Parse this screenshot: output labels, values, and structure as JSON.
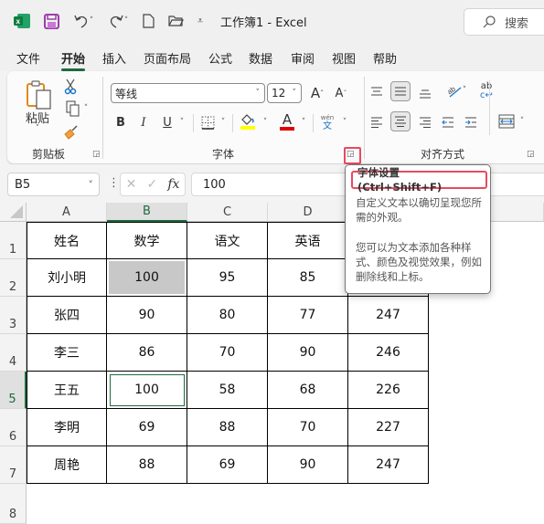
{
  "titlebar": {
    "title": "工作簿1  -  Excel",
    "search_label": "搜索",
    "icons": [
      "excel-logo-icon",
      "save-icon",
      "undo-icon",
      "redo-icon",
      "new-file-icon",
      "open-folder-icon",
      "customize-icon"
    ]
  },
  "tabs": [
    {
      "label": "文件",
      "active": false
    },
    {
      "label": "开始",
      "active": true
    },
    {
      "label": "插入",
      "active": false
    },
    {
      "label": "页面布局",
      "active": false
    },
    {
      "label": "公式",
      "active": false
    },
    {
      "label": "数据",
      "active": false
    },
    {
      "label": "审阅",
      "active": false
    },
    {
      "label": "视图",
      "active": false
    },
    {
      "label": "帮助",
      "active": false
    }
  ],
  "ribbon": {
    "clipboard": {
      "label": "剪贴板",
      "paste_label": "粘贴"
    },
    "font": {
      "label": "字体",
      "font_name": "等线",
      "font_size": "12",
      "bold": "B",
      "italic": "I",
      "underline": "U",
      "font_color_letter": "A",
      "phonetic_top": "wén",
      "phonetic_bottom": "文",
      "highlight_color": "#ffff00",
      "font_color": "#e00000"
    },
    "alignment": {
      "label": "对齐方式"
    }
  },
  "formula_bar": {
    "name_box": "B5",
    "fx": "fx",
    "value": "100"
  },
  "sheet": {
    "columns": [
      "A",
      "B",
      "C",
      "D"
    ],
    "selected_column": "B",
    "rows": [
      "1",
      "2",
      "3",
      "4",
      "5",
      "6",
      "7",
      "8"
    ],
    "selected_row": "5",
    "table": {
      "headers": [
        "姓名",
        "数学",
        "语文",
        "英语",
        ""
      ],
      "rows": [
        [
          "刘小明",
          "100",
          "95",
          "85",
          ""
        ],
        [
          "张四",
          "90",
          "80",
          "77",
          "247"
        ],
        [
          "李三",
          "86",
          "70",
          "90",
          "246"
        ],
        [
          "王五",
          "100",
          "58",
          "68",
          "226"
        ],
        [
          "李明",
          "69",
          "88",
          "70",
          "227"
        ],
        [
          "周艳",
          "88",
          "69",
          "90",
          "247"
        ]
      ]
    }
  },
  "tooltip": {
    "title": "字体设置 (Ctrl+Shift+F)",
    "para1": "自定义文本以确切呈现您所需的外观。",
    "para2": "您可以为文本添加各种样式、颜色及视觉效果，例如删除线和上标。"
  }
}
